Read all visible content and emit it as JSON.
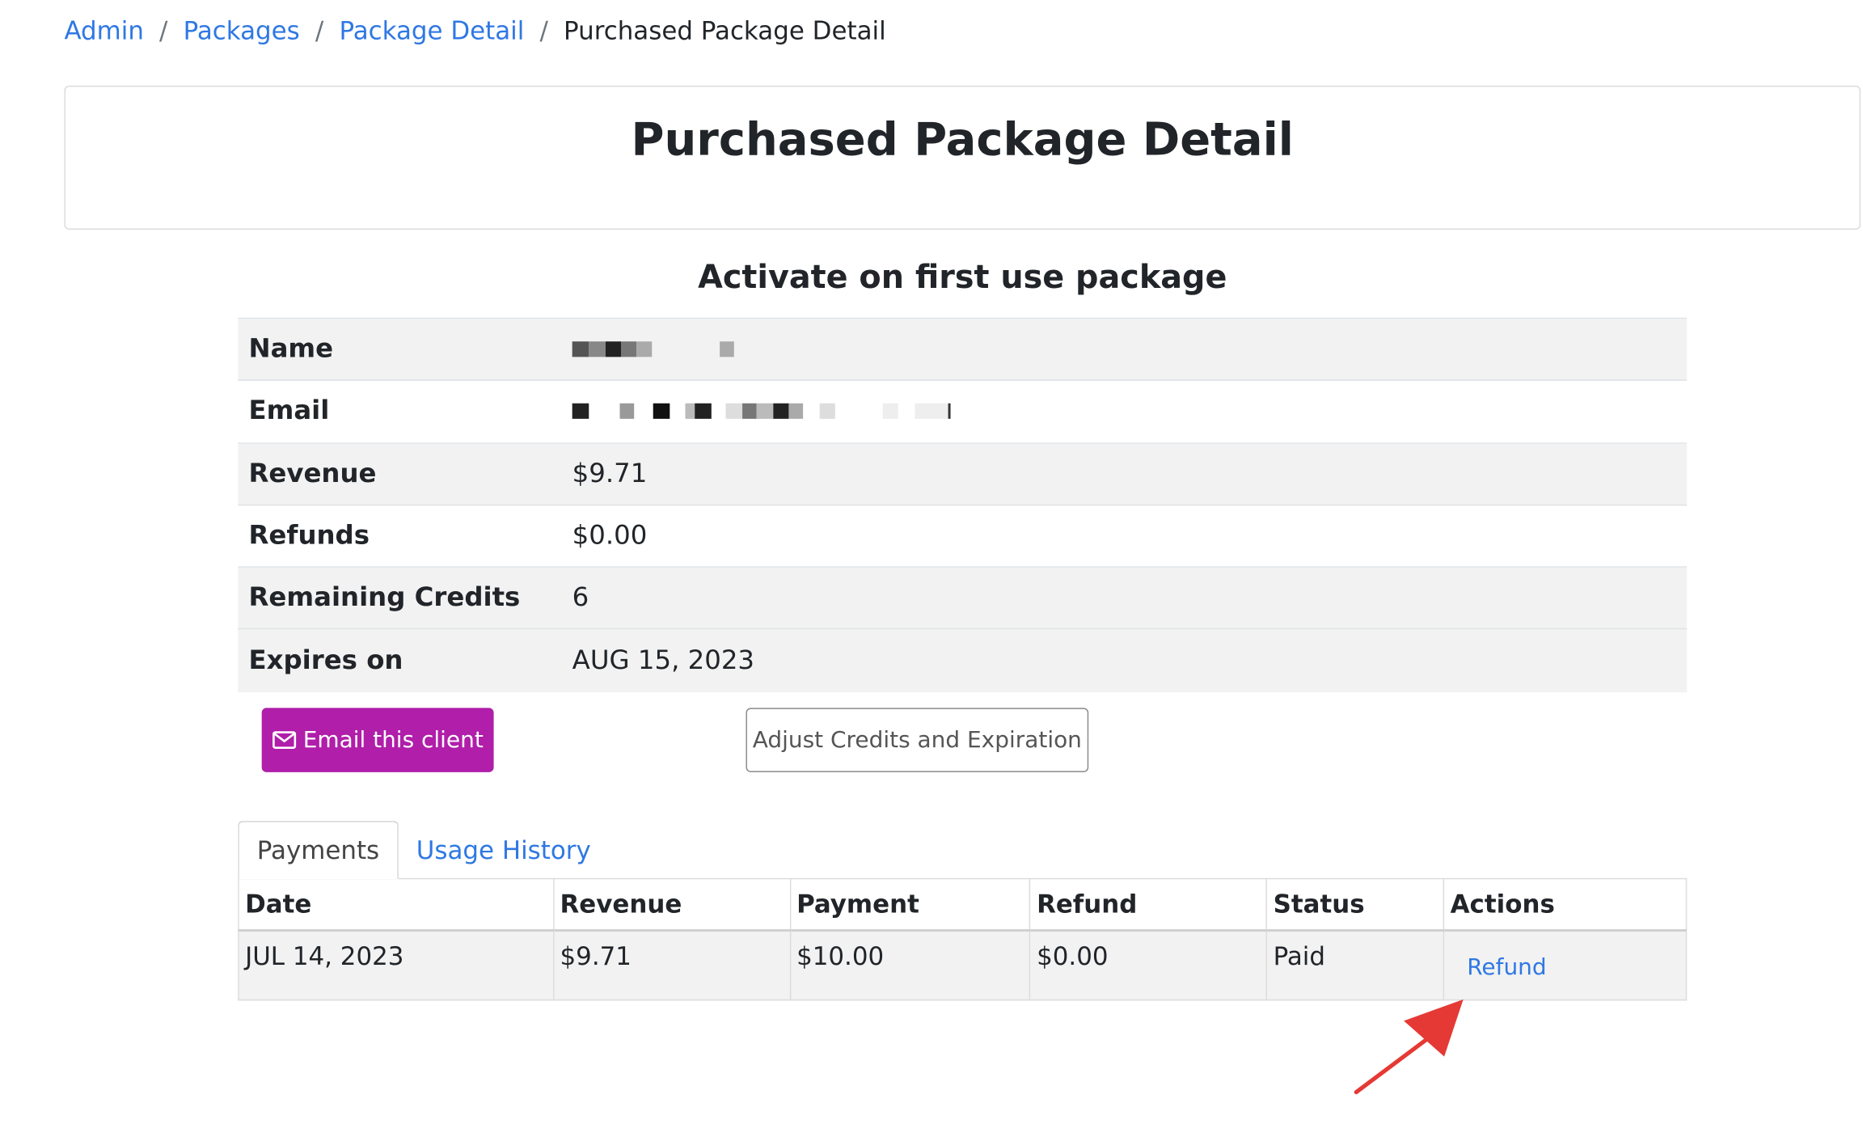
{
  "breadcrumb": {
    "items": [
      "Admin",
      "Packages",
      "Package Detail"
    ],
    "current": "Purchased Package Detail",
    "separator": "/"
  },
  "page_title": "Purchased Package Detail",
  "package_subtitle": "Activate on first use package",
  "details": {
    "name_label": "Name",
    "email_label": "Email",
    "revenue_label": "Revenue",
    "revenue_value": "$9.71",
    "refunds_label": "Refunds",
    "refunds_value": "$0.00",
    "credits_label": "Remaining Credits",
    "credits_value": "6",
    "expires_label": "Expires on",
    "expires_value": "AUG 15, 2023"
  },
  "buttons": {
    "email_client": "Email this client",
    "adjust": "Adjust Credits and Expiration"
  },
  "tabs": [
    "Payments",
    "Usage History"
  ],
  "payments": {
    "headers": [
      "Date",
      "Revenue",
      "Payment",
      "Refund",
      "Status",
      "Actions"
    ],
    "rows": [
      {
        "date": "JUL 14, 2023",
        "revenue": "$9.71",
        "payment": "$10.00",
        "refund": "$0.00",
        "status": "Paid",
        "action": "Refund"
      }
    ]
  },
  "colors": {
    "link": "#2f78e3",
    "email_button": "#b01eaa",
    "stripe": "#f2f2f2",
    "annotation_arrow": "#e53935"
  },
  "icons": {
    "email_button_icon": "envelope-icon",
    "annotation": "red-arrow-icon"
  }
}
